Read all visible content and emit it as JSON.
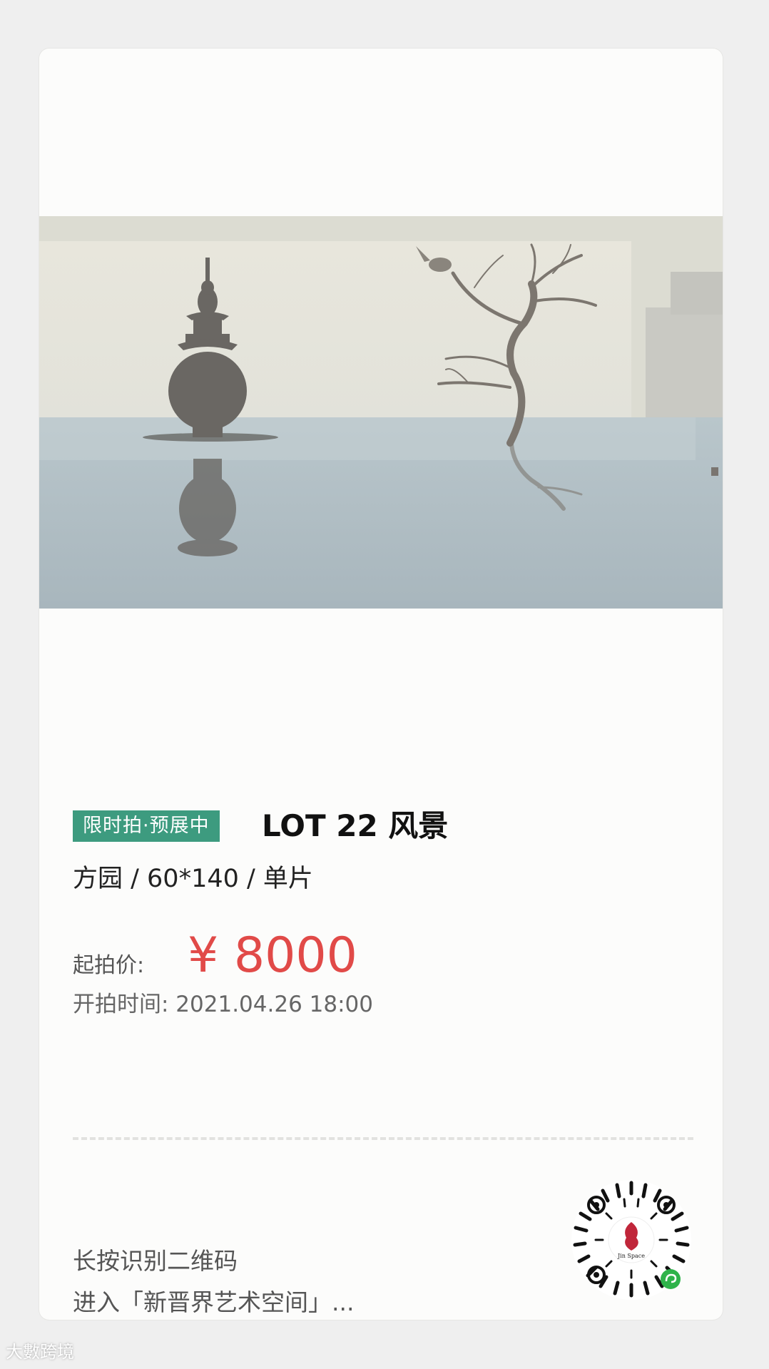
{
  "lot": {
    "tag": "限时拍·预展中",
    "title": "LOT 22  风景",
    "meta": "方园 / 60*140 / 单片"
  },
  "price": {
    "label": "起拍价:",
    "value": "¥  8000"
  },
  "start_time": {
    "text": "开拍时间:  2021.04.26 18:00"
  },
  "qr_hint": {
    "line1": "长按识别二维码",
    "line2": "进入「新晋界艺术空间」..."
  },
  "qr_logo_text": "Jin Space",
  "watermark": "大數跨境",
  "colors": {
    "tag_bg": "#3d9b7f",
    "price": "#e14a48"
  }
}
